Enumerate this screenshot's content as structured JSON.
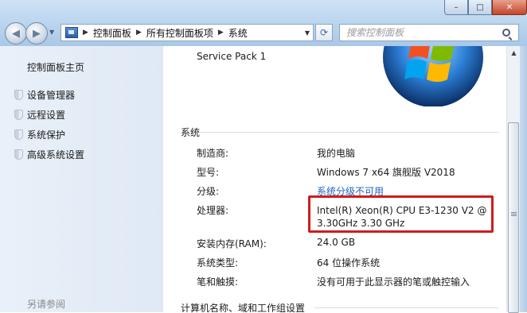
{
  "nav": {
    "breadcrumbs": [
      "控制面板",
      "所有控制面板项",
      "系统"
    ],
    "search_placeholder": "搜索控制面板"
  },
  "window_buttons": {
    "minimize": "–",
    "maximize": "□",
    "close": "✕"
  },
  "left_pane": {
    "home_link": "控制面板主页",
    "tasks": [
      "设备管理器",
      "远程设置",
      "系统保护",
      "高级系统设置"
    ],
    "see_also": "另请参阅"
  },
  "main": {
    "service_pack": "Service Pack 1",
    "system_section_title": "系统",
    "rows": [
      {
        "label": "制造商:",
        "value": "我的电脑"
      },
      {
        "label": "型号:",
        "value": "Windows 7 x64 旗舰版 V2018"
      },
      {
        "label": "分级:",
        "value": "系统分级不可用"
      },
      {
        "label": "处理器:",
        "value": "Intel(R) Xeon(R) CPU E3-1230 V2 @",
        "value_line2": "3.30GHz   3.30 GHz"
      },
      {
        "label": "安装内存(RAM):",
        "value": "24.0 GB"
      },
      {
        "label": "系统类型:",
        "value": "64 位操作系统"
      },
      {
        "label": "笔和触摸:",
        "value": "没有可用于此显示器的笔或触控输入"
      }
    ],
    "next_section_title": "计算机名称、域和工作组设置"
  },
  "colors": {
    "highlight_border": "#cd1d1d",
    "link": "#1f62c0"
  }
}
